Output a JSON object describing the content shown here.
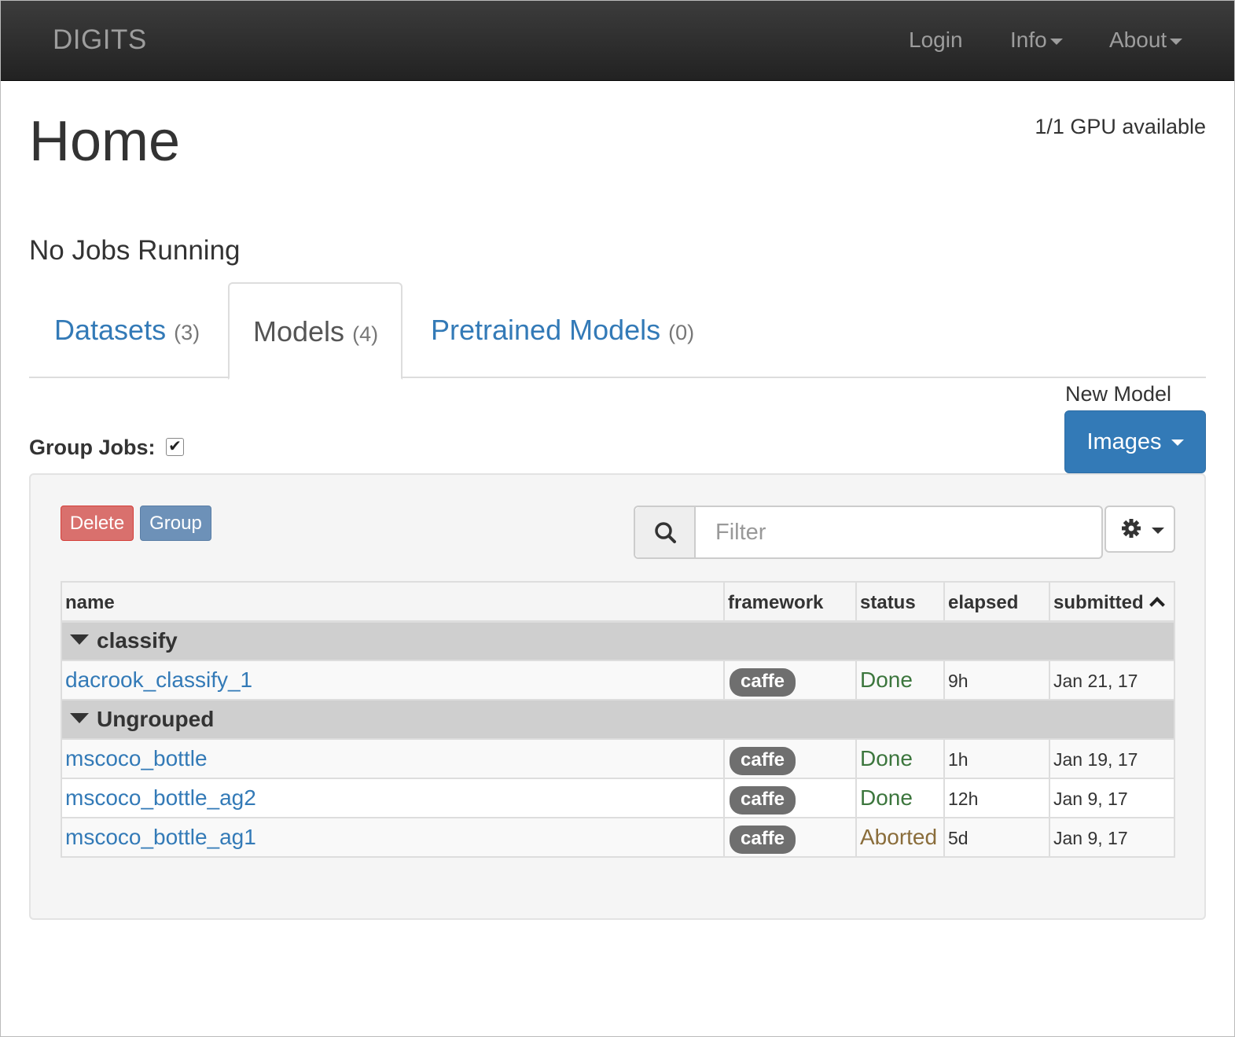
{
  "navbar": {
    "brand": "DIGITS",
    "login": "Login",
    "info": "Info",
    "about": "About"
  },
  "header": {
    "title": "Home",
    "gpu_status": "1/1 GPU available",
    "jobs_status": "No Jobs Running"
  },
  "tabs": [
    {
      "label": "Datasets",
      "count": "(3)",
      "active": false
    },
    {
      "label": "Models",
      "count": "(4)",
      "active": true
    },
    {
      "label": "Pretrained Models",
      "count": "(0)",
      "active": false
    }
  ],
  "new_model": {
    "label": "New Model",
    "button": "Images"
  },
  "group_jobs": {
    "label": "Group Jobs:",
    "checked": true,
    "check_mark": "✔"
  },
  "toolbar": {
    "delete_label": "Delete",
    "group_label": "Group",
    "filter_placeholder": "Filter"
  },
  "table": {
    "columns": [
      "name",
      "framework",
      "status",
      "elapsed",
      "submitted"
    ],
    "groups": [
      {
        "name": "classify",
        "rows": [
          {
            "name": "dacrook_classify_1",
            "framework": "caffe",
            "status": "Done",
            "elapsed": "9h",
            "submitted": "Jan 21, 17"
          }
        ]
      },
      {
        "name": "Ungrouped",
        "rows": [
          {
            "name": "mscoco_bottle",
            "framework": "caffe",
            "status": "Done",
            "elapsed": "1h",
            "submitted": "Jan 19, 17"
          },
          {
            "name": "mscoco_bottle_ag2",
            "framework": "caffe",
            "status": "Done",
            "elapsed": "12h",
            "submitted": "Jan 9, 17"
          },
          {
            "name": "mscoco_bottle_ag1",
            "framework": "caffe",
            "status": "Aborted",
            "elapsed": "5d",
            "submitted": "Jan 9, 17"
          }
        ]
      }
    ]
  },
  "colors": {
    "navbar_bg": "#222222",
    "link": "#337ab7",
    "primary": "#337ab7",
    "danger": "#d9706d",
    "done": "#3c763d",
    "aborted": "#8a6d3b"
  }
}
